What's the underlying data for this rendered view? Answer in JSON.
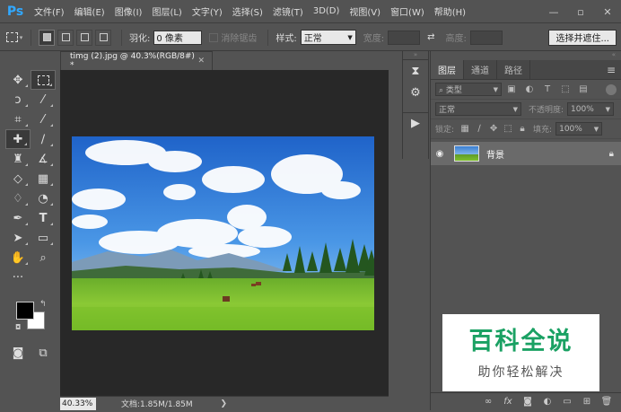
{
  "app": {
    "logo": "Ps"
  },
  "menu": [
    "文件(F)",
    "编辑(E)",
    "图像(I)",
    "图层(L)",
    "文字(Y)",
    "选择(S)",
    "滤镜(T)",
    "3D(D)",
    "视图(V)",
    "窗口(W)",
    "帮助(H)"
  ],
  "options": {
    "feather_label": "羽化:",
    "feather_value": "0 像素",
    "antialias_label": "消除锯齿",
    "style_label": "样式:",
    "style_value": "正常",
    "width_label": "宽度:",
    "height_label": "高度:",
    "select_mask_button": "选择并遮住..."
  },
  "document": {
    "tab_title": "timg (2).jpg @ 40.3%(RGB/8#) *",
    "zoom": "40.33%",
    "doc_info": "文档:1.85M/1.85M"
  },
  "layers_panel": {
    "tabs": [
      "图层",
      "通道",
      "路径"
    ],
    "filter_kind": "类型",
    "blend_mode": "正常",
    "opacity_label": "不透明度:",
    "opacity_value": "100%",
    "lock_label": "锁定:",
    "fill_label": "填充:",
    "fill_value": "100%",
    "layers": [
      {
        "name": "背景"
      }
    ]
  },
  "watermark": {
    "title": "百科全说",
    "subtitle": "助你轻松解决"
  },
  "colors": {
    "foreground": "#000000",
    "background": "#ffffff",
    "accent": "#31a8ff",
    "watermark_green": "#1aa163"
  }
}
